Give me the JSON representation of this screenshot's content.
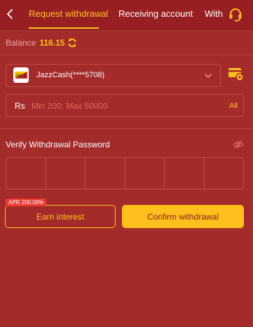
{
  "header": {
    "tabs": [
      {
        "label": "Request withdrawal",
        "active": true
      },
      {
        "label": "Receiving account",
        "active": false
      },
      {
        "label": "With",
        "active": false
      }
    ],
    "icons": {
      "back": "chevron-left-icon",
      "support": "headset-icon"
    }
  },
  "balance": {
    "label": "Balance",
    "value": "116.15",
    "icon": "refresh-icon"
  },
  "account": {
    "selected": "JazzCash(****5708)",
    "logo_text": "JAZZ",
    "icons": {
      "dropdown": "chevron-down-icon",
      "manage": "card-settings-icon"
    }
  },
  "amount": {
    "currency_symbol": "Rs",
    "value": "",
    "placeholder": "Min 200, Max 50000",
    "all_label": "All"
  },
  "password": {
    "label": "Verify Withdrawal Password",
    "digits": [
      "",
      "",
      "",
      "",
      "",
      ""
    ],
    "icon": "eye-off-icon"
  },
  "actions": {
    "apr_badge": "APR 200.00%",
    "earn_label": "Earn interest",
    "confirm_label": "Confirm withdrawal"
  },
  "colors": {
    "background": "#a32b29",
    "header": "#981f21",
    "accent": "#ffc01e",
    "border": "#c24d48",
    "badge": "#ed3b33"
  }
}
